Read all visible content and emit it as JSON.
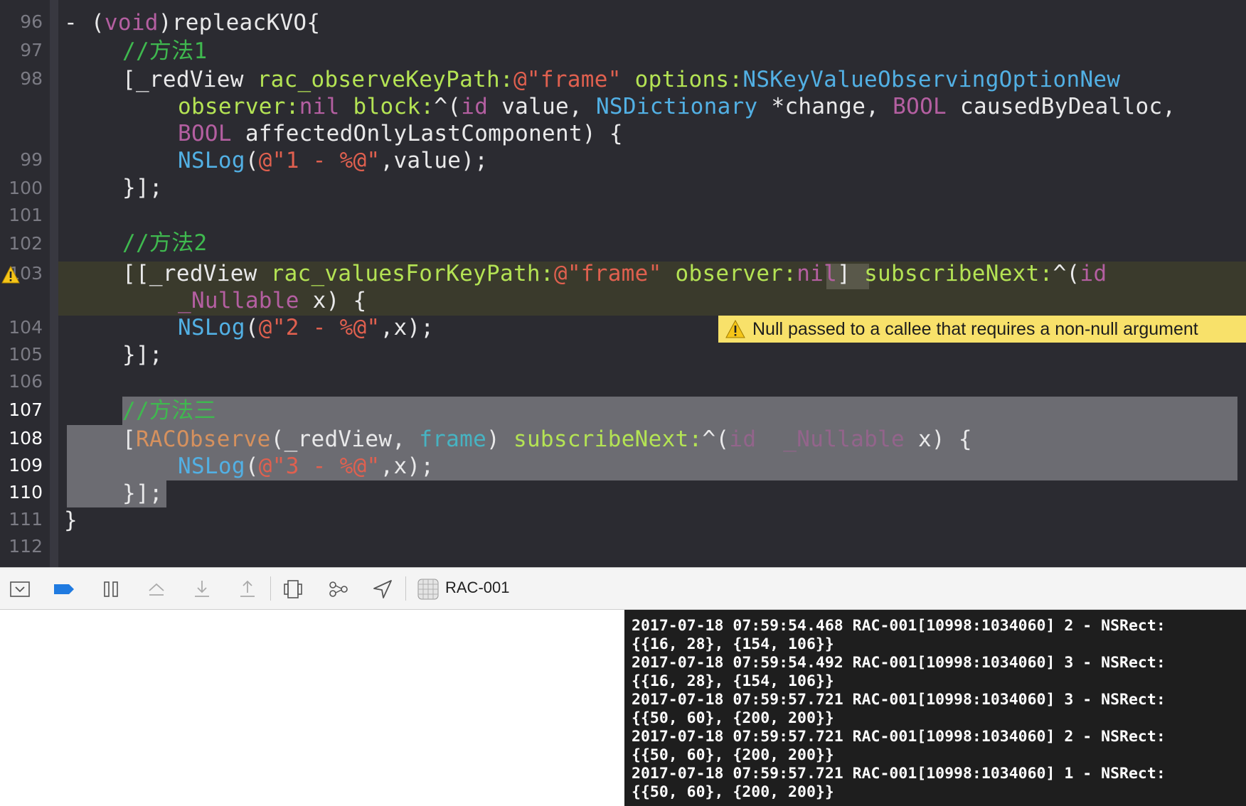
{
  "editor": {
    "line_numbers": [
      "96",
      "97",
      "98",
      "99",
      "100",
      "101",
      "102",
      "103",
      "104",
      "105",
      "106",
      "107",
      "108",
      "109",
      "110",
      "111",
      "112"
    ],
    "code": {
      "l96": {
        "dash": "- (",
        "void": "void",
        "name": ")repleacKVO{"
      },
      "l97": {
        "comment": "//方法1"
      },
      "l98a": {
        "open": "[_redView ",
        "method": "rac_observeKeyPath:",
        "str": "@\"frame\"",
        "opt": " options:",
        "const": "NSKeyValueObservingOptionNew"
      },
      "l98b": {
        "observer": "observer:",
        "nil": "nil",
        "block": " block:",
        "caret": "^(",
        "id": "id",
        "value": " value, ",
        "dict": "NSDictionary",
        "change": " *change, ",
        "bool": "BOOL",
        "caused": " causedByDealloc,"
      },
      "l98c": {
        "bool": "BOOL",
        "rest": " affectedOnlyLastComponent) {"
      },
      "l99": {
        "nslog": "NSLog",
        "paren": "(",
        "str": "@\"1 - %@\"",
        "rest": ",value);"
      },
      "l100": {
        "text": "}];"
      },
      "l102": {
        "comment": "//方法2"
      },
      "l103a": {
        "open": "[[_redView ",
        "method": "rac_valuesForKeyPath:",
        "str": "@\"frame\"",
        "observer": " observer:",
        "nil": "nil",
        "close": "] ",
        "sub": "subscribeNext:",
        "caret": "^(",
        "id": "id"
      },
      "l103b": {
        "nullable": "_Nullable",
        "rest": " x) {"
      },
      "l104": {
        "nslog": "NSLog",
        "paren": "(",
        "str": "@\"2 - %@\"",
        "rest": ",x);"
      },
      "l105": {
        "text": "}];"
      },
      "l107": {
        "comment": "//方法三"
      },
      "l108": {
        "open": "[",
        "macro": "RACObserve",
        "args": "(_redView, ",
        "prop": "frame",
        "close": ") ",
        "sub": "subscribeNext:",
        "caret": "^(",
        "id": "id",
        "nullable": "_Nullable",
        "rest": " x) {"
      },
      "l109": {
        "nslog": "NSLog",
        "paren": "(",
        "str": "@\"3 - %@\"",
        "rest": ",x);"
      },
      "l110": {
        "text": "}];"
      },
      "l111": {
        "text": "}"
      }
    },
    "warning": {
      "message": "Null passed to a callee that requires a non-null argument",
      "line": "103"
    }
  },
  "toolbar": {
    "icons": [
      "hide-debug-area-icon",
      "breakpoints-toggle-icon",
      "pause-icon",
      "step-over-icon",
      "step-into-icon",
      "step-out-icon",
      "view-hierarchy-icon",
      "memory-graph-icon",
      "simulate-location-icon",
      "app-icon"
    ],
    "target_label": "RAC-001"
  },
  "console": {
    "lines": [
      "2017-07-18 07:59:54.468 RAC-001[10998:1034060] 2 - NSRect:",
      "{{16, 28}, {154, 106}}",
      "2017-07-18 07:59:54.492 RAC-001[10998:1034060] 3 - NSRect:",
      "{{16, 28}, {154, 106}}",
      "2017-07-18 07:59:57.721 RAC-001[10998:1034060] 3 - NSRect:",
      "{{50, 60}, {200, 200}}",
      "2017-07-18 07:59:57.721 RAC-001[10998:1034060] 2 - NSRect:",
      "{{50, 60}, {200, 200}}",
      "2017-07-18 07:59:57.721 RAC-001[10998:1034060] 1 - NSRect:",
      "{{50, 60}, {200, 200}}"
    ]
  },
  "colors": {
    "editor_bg": "#2b2b31",
    "comment": "#3fb94f",
    "keyword": "#b45fa1",
    "string": "#e0604f",
    "method": "#b4e354",
    "warning": "#f8e16a"
  }
}
